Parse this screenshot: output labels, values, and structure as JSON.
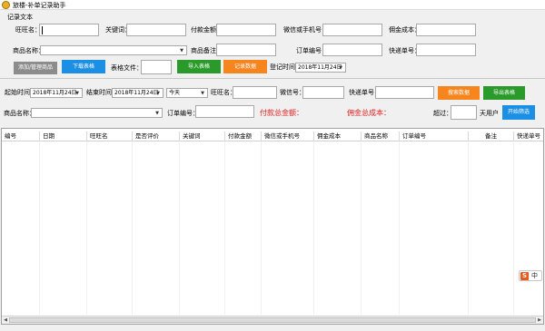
{
  "window": {
    "title": "旅楼-补单记录助手"
  },
  "section": {
    "title": "记录文本"
  },
  "record": {
    "wangwang_label": "旺旺名：",
    "keyword_label": "关键词：",
    "payment_label": "付款金额：",
    "wechat_label": "微信或手机号：",
    "commission_label": "佣金成本：",
    "product_label": "商品名称：",
    "product_value": "",
    "product_note_label": "商品备注：",
    "order_label": "订单编号：",
    "express_label": "快递单号：",
    "add_manage_label": "添加/管理商品",
    "download_label": "下载表格",
    "table_file_label": "表格文件：",
    "import_label": "导入表格",
    "record_label": "记录数据",
    "reg_time_label": "登记时间：",
    "reg_time_value": "2018年11月24日"
  },
  "search": {
    "start_label": "起始时间：",
    "start_value": "2018年11月24日",
    "end_label": "结束时间：",
    "end_value": "2018年11月24日",
    "range_value": "今天",
    "wangwang_label": "旺旺名：",
    "wechat_label": "微信号：",
    "express_label": "快递单号：",
    "search_label": "搜索数据",
    "export_label": "导出表格",
    "product_label": "商品名称：",
    "order_label": "订单编号：",
    "total_payment_label": "付款总金额：",
    "total_commission_label": "佣金总成本：",
    "over_label": "超过：",
    "days_label": "天用户",
    "filter_label": "开始筛选"
  },
  "table": {
    "columns": [
      "编号",
      "日期",
      "旺旺名",
      "是否评价",
      "关键词",
      "付款金额",
      "微信或手机号",
      "佣金成本",
      "商品名称",
      "订单编号",
      "备注",
      "快递单号"
    ]
  },
  "ime": {
    "label": "中"
  },
  "colors": {
    "blue": "#1a8fe3",
    "green": "#2a9a2a",
    "orange": "#f7851e",
    "gray": "#8c8c8c",
    "red": "#e02020"
  }
}
